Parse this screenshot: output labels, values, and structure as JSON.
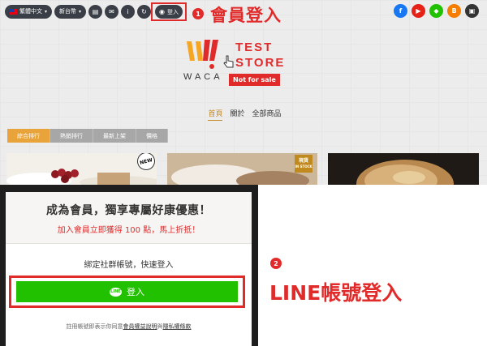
{
  "topbar": {
    "language": "繁體中文",
    "currency": "新台幣",
    "login_label": "登入"
  },
  "annotations": {
    "step1_number": "1",
    "step1_label": "會員登入",
    "step2_number": "2",
    "step2_label": "LINE帳號登入"
  },
  "logo": {
    "brand": "WACA",
    "line1": "TEST",
    "line2": "STORE",
    "badge": "Not for sale"
  },
  "mainnav": [
    "首頁",
    "關於",
    "全部商品"
  ],
  "tabs": [
    "綜合排行",
    "熱銷排行",
    "最新上架",
    "價格"
  ],
  "badges": {
    "new": "NEW",
    "stock_top": "現貨",
    "stock_bottom": "IN STOCK"
  },
  "login_panel": {
    "title": "成為會員，獨享專屬好康優惠！",
    "subtitle": "加入會員立即獲得 100 點，馬上折抵！",
    "bind_text": "綁定社群帳號，快速登入",
    "line_icon_text": "LINE",
    "line_button": "登入",
    "terms_prefix": "註冊帳號即表示你同意",
    "terms_link1": "會員權益說明",
    "terms_and": "與",
    "terms_link2": "隱私權條款"
  },
  "colors": {
    "accent_red": "#e12b2b",
    "line_green": "#21c100",
    "tab_active": "#e8a33a",
    "nav_active": "#c58a2a"
  }
}
